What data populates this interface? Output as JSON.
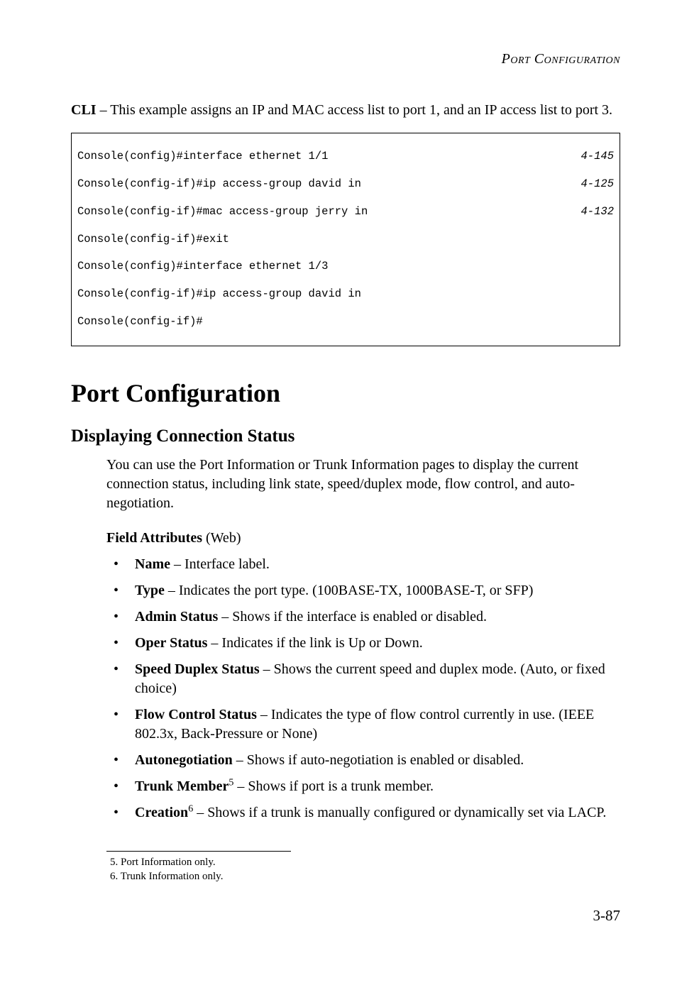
{
  "header": "Port Configuration",
  "lead": {
    "prefix": "CLI",
    "text": " – This example assigns an IP and MAC access list to port 1, and an IP access list to port 3."
  },
  "code": {
    "lines": [
      {
        "text": "Console(config)#interface ethernet 1/1",
        "ref": "4-145"
      },
      {
        "text": "Console(config-if)#ip access-group david in",
        "ref": "4-125"
      },
      {
        "text": "Console(config-if)#mac access-group jerry in",
        "ref": "4-132"
      },
      {
        "text": "Console(config-if)#exit",
        "ref": ""
      },
      {
        "text": "Console(config)#interface ethernet 1/3",
        "ref": ""
      },
      {
        "text": "Console(config-if)#ip access-group david in",
        "ref": ""
      },
      {
        "text": "Console(config-if)#",
        "ref": ""
      }
    ]
  },
  "section_title": "Port Configuration",
  "subsection_title": "Displaying Connection Status",
  "intro_para": "You can use the Port Information or Trunk Information pages to display the current connection status, including link state, speed/duplex mode, flow control, and auto-negotiation.",
  "field_attributes": {
    "label": "Field Attributes",
    "suffix": " (Web)"
  },
  "bullets": [
    {
      "term": "Name",
      "desc": " – Interface label."
    },
    {
      "term": "Type",
      "desc": " – Indicates the port type. (100BASE-TX, 1000BASE-T, or SFP)"
    },
    {
      "term": "Admin Status",
      "desc": " – Shows if the interface is enabled or disabled."
    },
    {
      "term": "Oper Status",
      "desc": " – Indicates if the link is Up or Down."
    },
    {
      "term": "Speed Duplex Status",
      "desc": " – Shows the current speed and duplex mode. (Auto, or fixed choice)"
    },
    {
      "term": "Flow Control Status",
      "desc": " – Indicates the type of flow control currently in use. (IEEE 802.3x, Back-Pressure or None)"
    },
    {
      "term": "Autonegotiation",
      "desc": " – Shows if auto-negotiation is enabled or disabled."
    },
    {
      "term": "Trunk Member",
      "sup": "5",
      "desc": " – Shows if port is a trunk member."
    },
    {
      "term": "Creation",
      "sup": "6",
      "desc": " – Shows if a trunk is manually configured or dynamically set via LACP."
    }
  ],
  "footnotes": [
    "5. Port Information only.",
    "6. Trunk Information only."
  ],
  "page_number": "3-87"
}
